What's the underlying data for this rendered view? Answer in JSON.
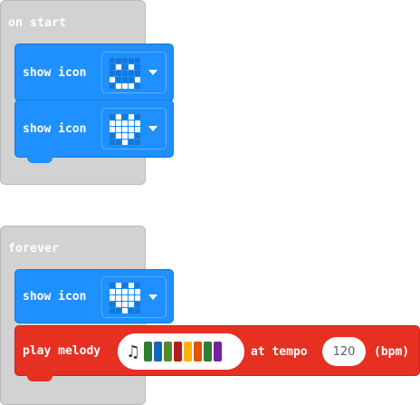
{
  "on_start": {
    "label": "on start",
    "blocks": [
      {
        "label": "show icon",
        "icon": "happy-face-icon",
        "leds": [
          0,
          0,
          0,
          0,
          0,
          0,
          1,
          0,
          1,
          0,
          0,
          0,
          0,
          0,
          0,
          1,
          0,
          0,
          0,
          1,
          0,
          1,
          1,
          1,
          0
        ]
      },
      {
        "label": "show icon",
        "icon": "heart-icon",
        "leds": [
          0,
          1,
          0,
          1,
          0,
          1,
          1,
          1,
          1,
          1,
          1,
          1,
          1,
          1,
          1,
          0,
          1,
          1,
          1,
          0,
          0,
          0,
          1,
          0,
          0
        ]
      }
    ]
  },
  "forever": {
    "label": "forever",
    "show_icon": {
      "label": "show icon",
      "icon": "heart-icon",
      "leds": [
        0,
        1,
        0,
        1,
        0,
        1,
        1,
        1,
        1,
        1,
        1,
        1,
        1,
        1,
        1,
        0,
        1,
        1,
        1,
        0,
        0,
        0,
        1,
        0,
        0
      ]
    },
    "play_melody": {
      "label": "play melody",
      "at_tempo_label": "at tempo",
      "tempo_value": "120",
      "unit_label": "(bpm)",
      "note_icon": "music-note-icon",
      "note_colors": [
        "#2e7d32",
        "#1565c0",
        "#558b2f",
        "#b71c1c",
        "#ffb300",
        "#e65100",
        "#2e7d32",
        "#7b1fa2"
      ]
    }
  },
  "colors": {
    "basic_blue": "#1e90ff",
    "music_red": "#e63022",
    "event_gray": "#d2d2d2"
  }
}
